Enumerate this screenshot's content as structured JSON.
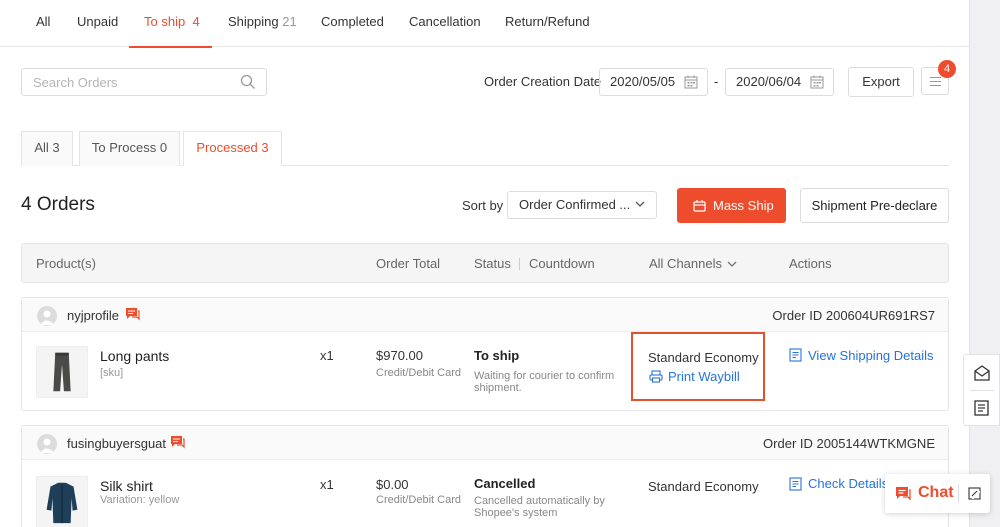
{
  "top_tabs": [
    {
      "label": "All",
      "count": ""
    },
    {
      "label": "Unpaid",
      "count": ""
    },
    {
      "label": "To ship",
      "count": "4"
    },
    {
      "label": "Shipping",
      "count": "21"
    },
    {
      "label": "Completed",
      "count": ""
    },
    {
      "label": "Cancellation",
      "count": ""
    },
    {
      "label": "Return/Refund",
      "count": ""
    }
  ],
  "filter": {
    "search_placeholder": "Search Orders",
    "date_label": "Order Creation Date",
    "date_from": "2020/05/05",
    "date_sep": "-",
    "date_to": "2020/06/04",
    "export_label": "Export",
    "notification_count": "4"
  },
  "sub_tabs": [
    {
      "label": "All 3"
    },
    {
      "label": "To Process 0"
    },
    {
      "label": "Processed 3"
    }
  ],
  "orders_header": {
    "count_label": "4 Orders",
    "sort_label": "Sort by",
    "sort_value": "Order Confirmed ...",
    "mass_ship_label": "Mass Ship",
    "predeclare_label": "Shipment Pre-declare"
  },
  "table_header": {
    "product": "Product(s)",
    "total": "Order Total",
    "status": "Status",
    "countdown": "Countdown",
    "channels": "All Channels",
    "actions": "Actions"
  },
  "orders": [
    {
      "buyer": "nyjprofile",
      "order_id": "Order ID 200604UR691RS7",
      "product_name": "Long pants",
      "product_sub": "[sku]",
      "qty": "x1",
      "total": "$970.00",
      "payment": "Credit/Debit Card",
      "status": "To ship",
      "status_desc": "Waiting for courier to confirm shipment.",
      "channel": "Standard Economy",
      "channel_link": "Print Waybill",
      "action": "View Shipping Details"
    },
    {
      "buyer": "fusingbuyersguat",
      "order_id": "Order ID 2005144WTKMGNE",
      "product_name": "Silk shirt",
      "product_sub": "Variation: yellow",
      "qty": "x1",
      "total": "$0.00",
      "payment": "Credit/Debit Card",
      "status": "Cancelled",
      "status_desc": "Cancelled automatically by Shopee's system",
      "channel": "Standard Economy",
      "action": "Check Details"
    }
  ],
  "chat": {
    "label": "Chat"
  },
  "colors": {
    "accent": "#ee4d2d",
    "link": "#2673dd"
  }
}
